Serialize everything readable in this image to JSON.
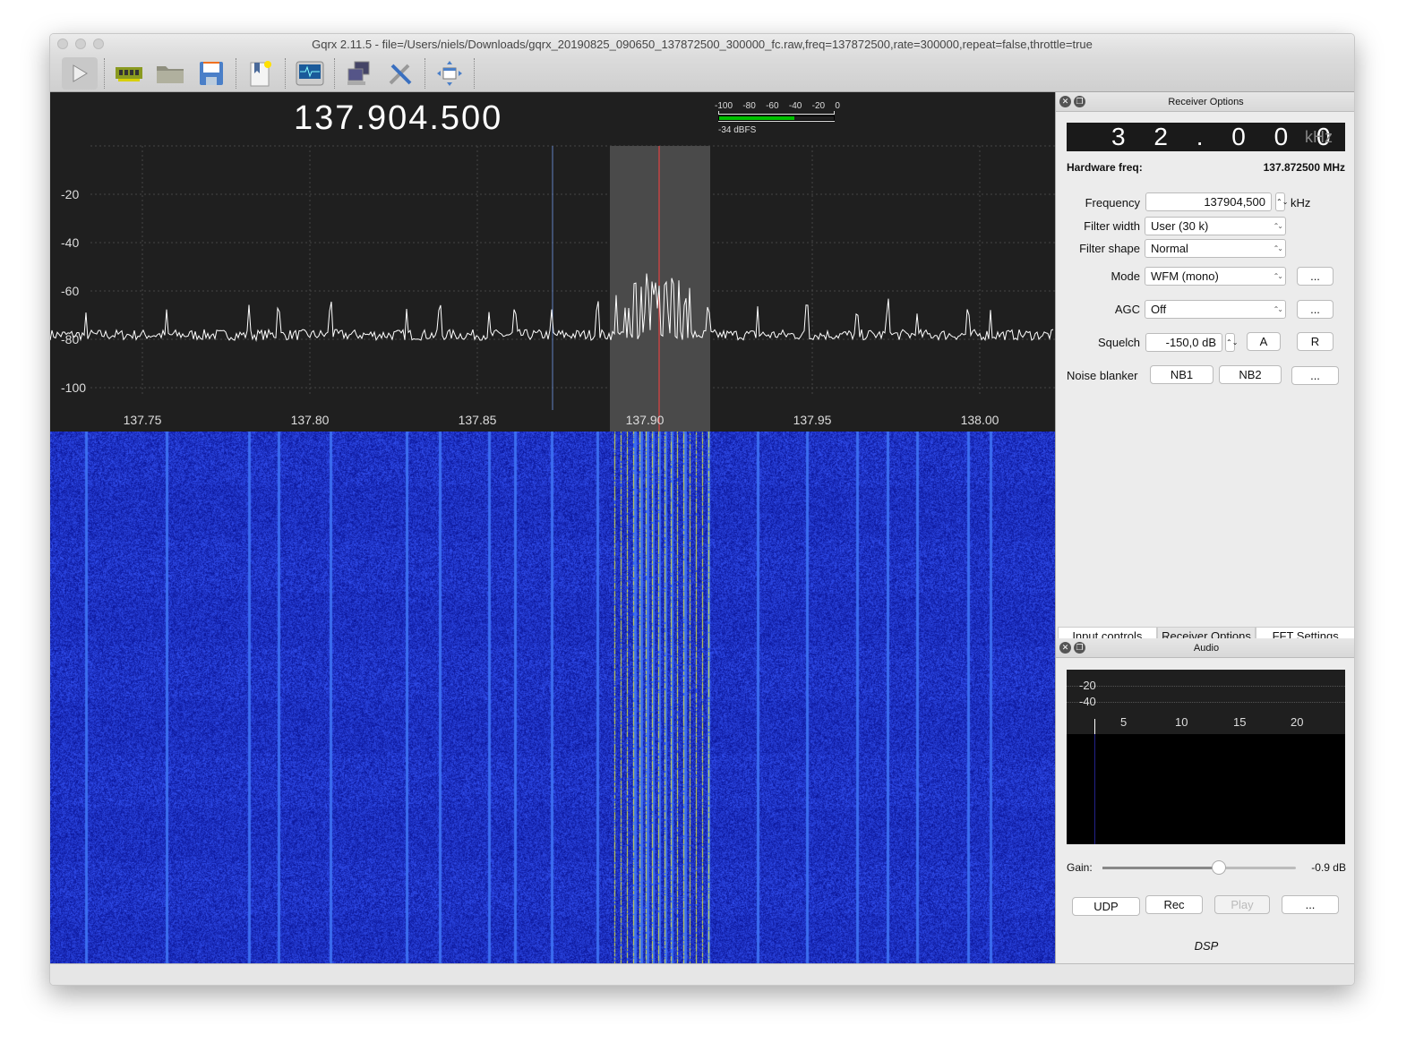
{
  "window": {
    "title": "Gqrx 2.11.5 - file=/Users/niels/Downloads/gqrx_20190825_090650_137872500_300000_fc.raw,freq=137872500,rate=300000,repeat=false,throttle=true"
  },
  "toolbar": {
    "icons": [
      "play-icon",
      "hardware-icon",
      "open-folder-icon",
      "save-icon",
      "bookmark-icon",
      "signal-monitor-icon",
      "network-icon",
      "tools-icon",
      "fullscreen-icon"
    ]
  },
  "spectrum": {
    "center_freq": "137.904.500",
    "y_ticks": [
      "-20",
      "-40",
      "-60",
      "-80",
      "-100"
    ],
    "x_ticks": [
      "137.75",
      "137.80",
      "137.85",
      "137.90",
      "137.95",
      "138.00"
    ],
    "colors": {
      "filter_line": "#ff4040",
      "hw_line": "#6080c0",
      "trace": "#ffffff"
    }
  },
  "meter": {
    "ticks": [
      "-100",
      "-80",
      "-60",
      "-40",
      "-20",
      "0"
    ],
    "level_dbfs": -34,
    "label": "-34 dBFS",
    "color": "#00c000"
  },
  "receiver": {
    "title": "Receiver Options",
    "offset_digits": "3 2 . 0 0 0",
    "offset_unit": "kHz",
    "hw_label": "Hardware freq:",
    "hw_value": "137.872500 MHz",
    "freq_label": "Frequency",
    "freq_value": "137904,500",
    "freq_unit": "kHz",
    "fw_label": "Filter width",
    "fw_value": "User (30 k)",
    "fs_label": "Filter shape",
    "fs_value": "Normal",
    "mode_label": "Mode",
    "mode_value": "WFM (mono)",
    "more": "...",
    "agc_label": "AGC",
    "agc_value": "Off",
    "sq_label": "Squelch",
    "sq_value": "-150,0 dB",
    "a": "A",
    "r": "R",
    "nb_label": "Noise blanker",
    "nb1": "NB1",
    "nb2": "NB2"
  },
  "tabs": [
    {
      "label": "Input controls"
    },
    {
      "label": "Receiver Options"
    },
    {
      "label": "FFT Settings"
    }
  ],
  "audio": {
    "title": "Audio",
    "y_ticks": [
      "-20",
      "-40"
    ],
    "x_ticks": [
      "5",
      "10",
      "15",
      "20"
    ],
    "gain_label": "Gain:",
    "gain_value": "-0.9 dB",
    "gain_fraction": 0.6,
    "udp": "UDP",
    "rec": "Rec",
    "play": "Play",
    "more": "...",
    "dsp": "DSP"
  }
}
